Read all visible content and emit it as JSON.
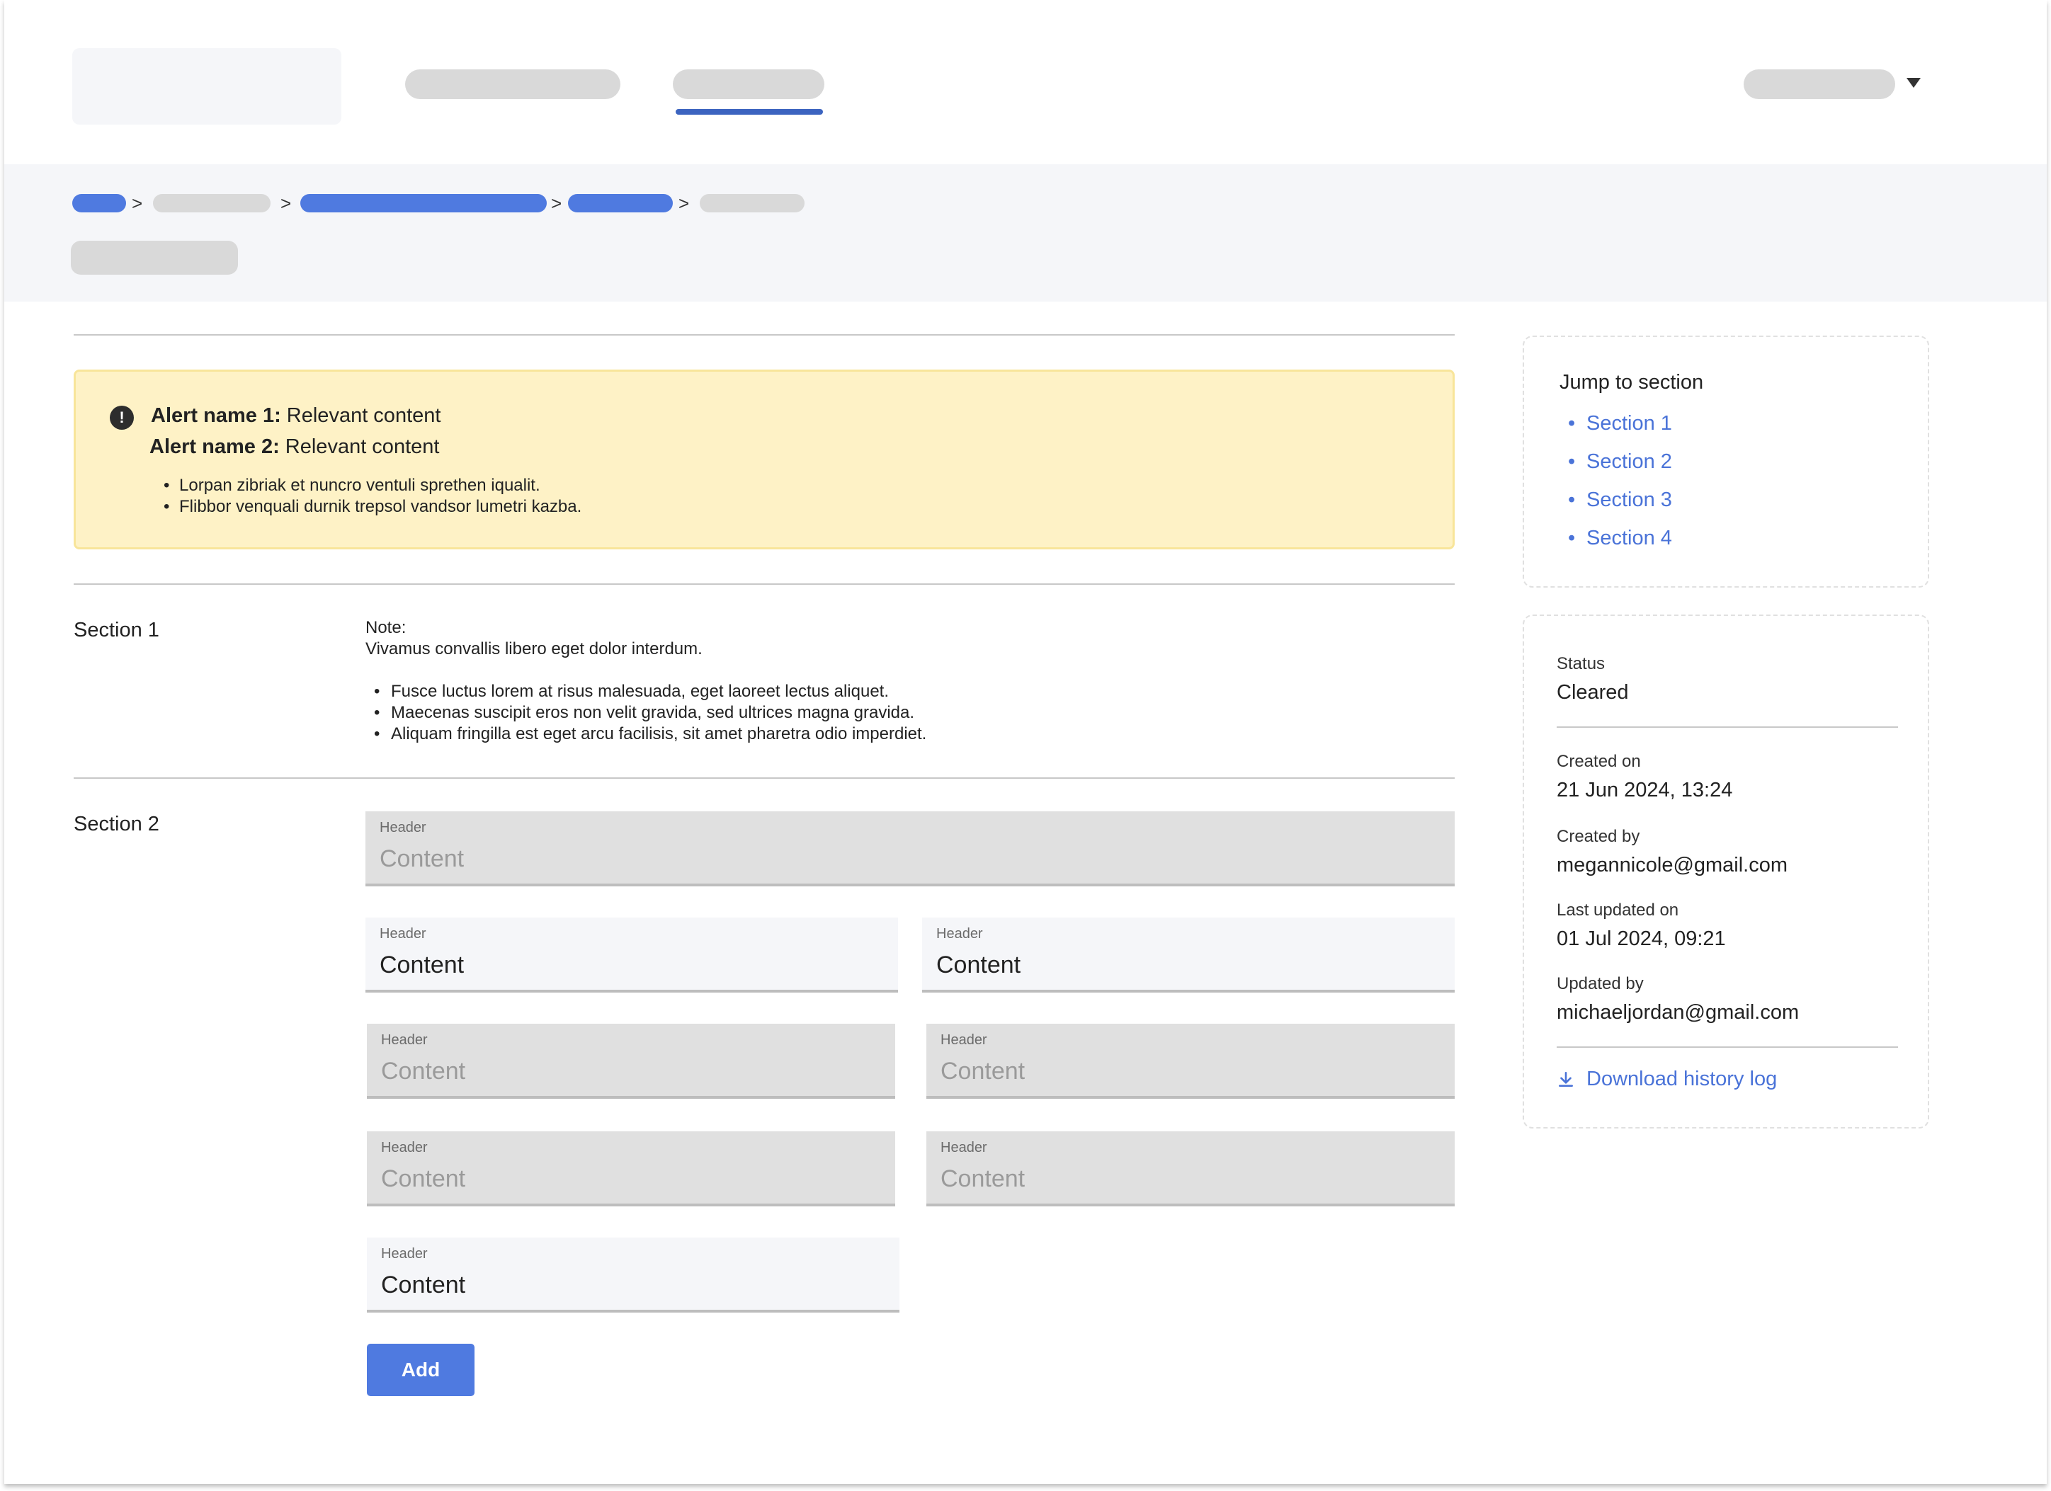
{
  "header": {
    "logo": "logo",
    "active_nav_indicator_color": "#3c64c0",
    "user_menu_icon": "caret-down-icon"
  },
  "breadcrumb": {
    "separators": [
      ">",
      ">",
      ">",
      ">"
    ],
    "link_color": "#4f7ae0"
  },
  "alert": {
    "icon": "exclamation-circle-icon",
    "mark": "!",
    "items": [
      {
        "name": "Alert name 1:",
        "content": "Relevant content"
      },
      {
        "name": "Alert name 2:",
        "content": "Relevant content"
      }
    ],
    "bullets": [
      "Lorpan zibriak et nuncro ventuli sprethen iqualit.",
      "Flibbor venquali durnik trepsol vandsor lumetri kazba."
    ],
    "background_color": "#fef2c6"
  },
  "section1": {
    "label": "Section 1",
    "note_title": "Note:",
    "note_text": "Vivamus convallis libero eget dolor interdum.",
    "bullets": [
      "Fusce luctus lorem at risus malesuada, eget laoreet lectus aliquet.",
      "Maecenas suscipit eros non velit gravida, sed ultrices magna gravida.",
      "Aliquam fringilla est eget arcu facilisis, sit amet pharetra odio imperdiet."
    ]
  },
  "section2": {
    "label": "Section 2",
    "fields": [
      {
        "header": "Header",
        "content": "Content",
        "state": "disabled"
      },
      {
        "header": "Header",
        "content": "Content",
        "state": "enabled"
      },
      {
        "header": "Header",
        "content": "Content",
        "state": "enabled"
      },
      {
        "header": "Header",
        "content": "Content",
        "state": "disabled"
      },
      {
        "header": "Header",
        "content": "Content",
        "state": "disabled"
      },
      {
        "header": "Header",
        "content": "Content",
        "state": "disabled"
      },
      {
        "header": "Header",
        "content": "Content",
        "state": "disabled"
      },
      {
        "header": "Header",
        "content": "Content",
        "state": "enabled"
      }
    ],
    "add_button": "Add",
    "button_color": "#4f7ae0"
  },
  "sidebar": {
    "jump_title": "Jump to section",
    "jump_links": [
      "Section 1",
      "Section 2",
      "Section 3",
      "Section 4"
    ],
    "link_color": "#4a73d8",
    "status_label": "Status",
    "status_value": "Cleared",
    "created_on_label": "Created on",
    "created_on_value": "21 Jun 2024, 13:24",
    "created_by_label": "Created by",
    "created_by_value": "megannicole@gmail.com",
    "updated_on_label": "Last updated on",
    "updated_on_value": "01 Jul 2024, 09:21",
    "updated_by_label": "Updated by",
    "updated_by_value": "michaeljordan@gmail.com",
    "download_label": "Download history log",
    "download_icon": "download-icon"
  }
}
